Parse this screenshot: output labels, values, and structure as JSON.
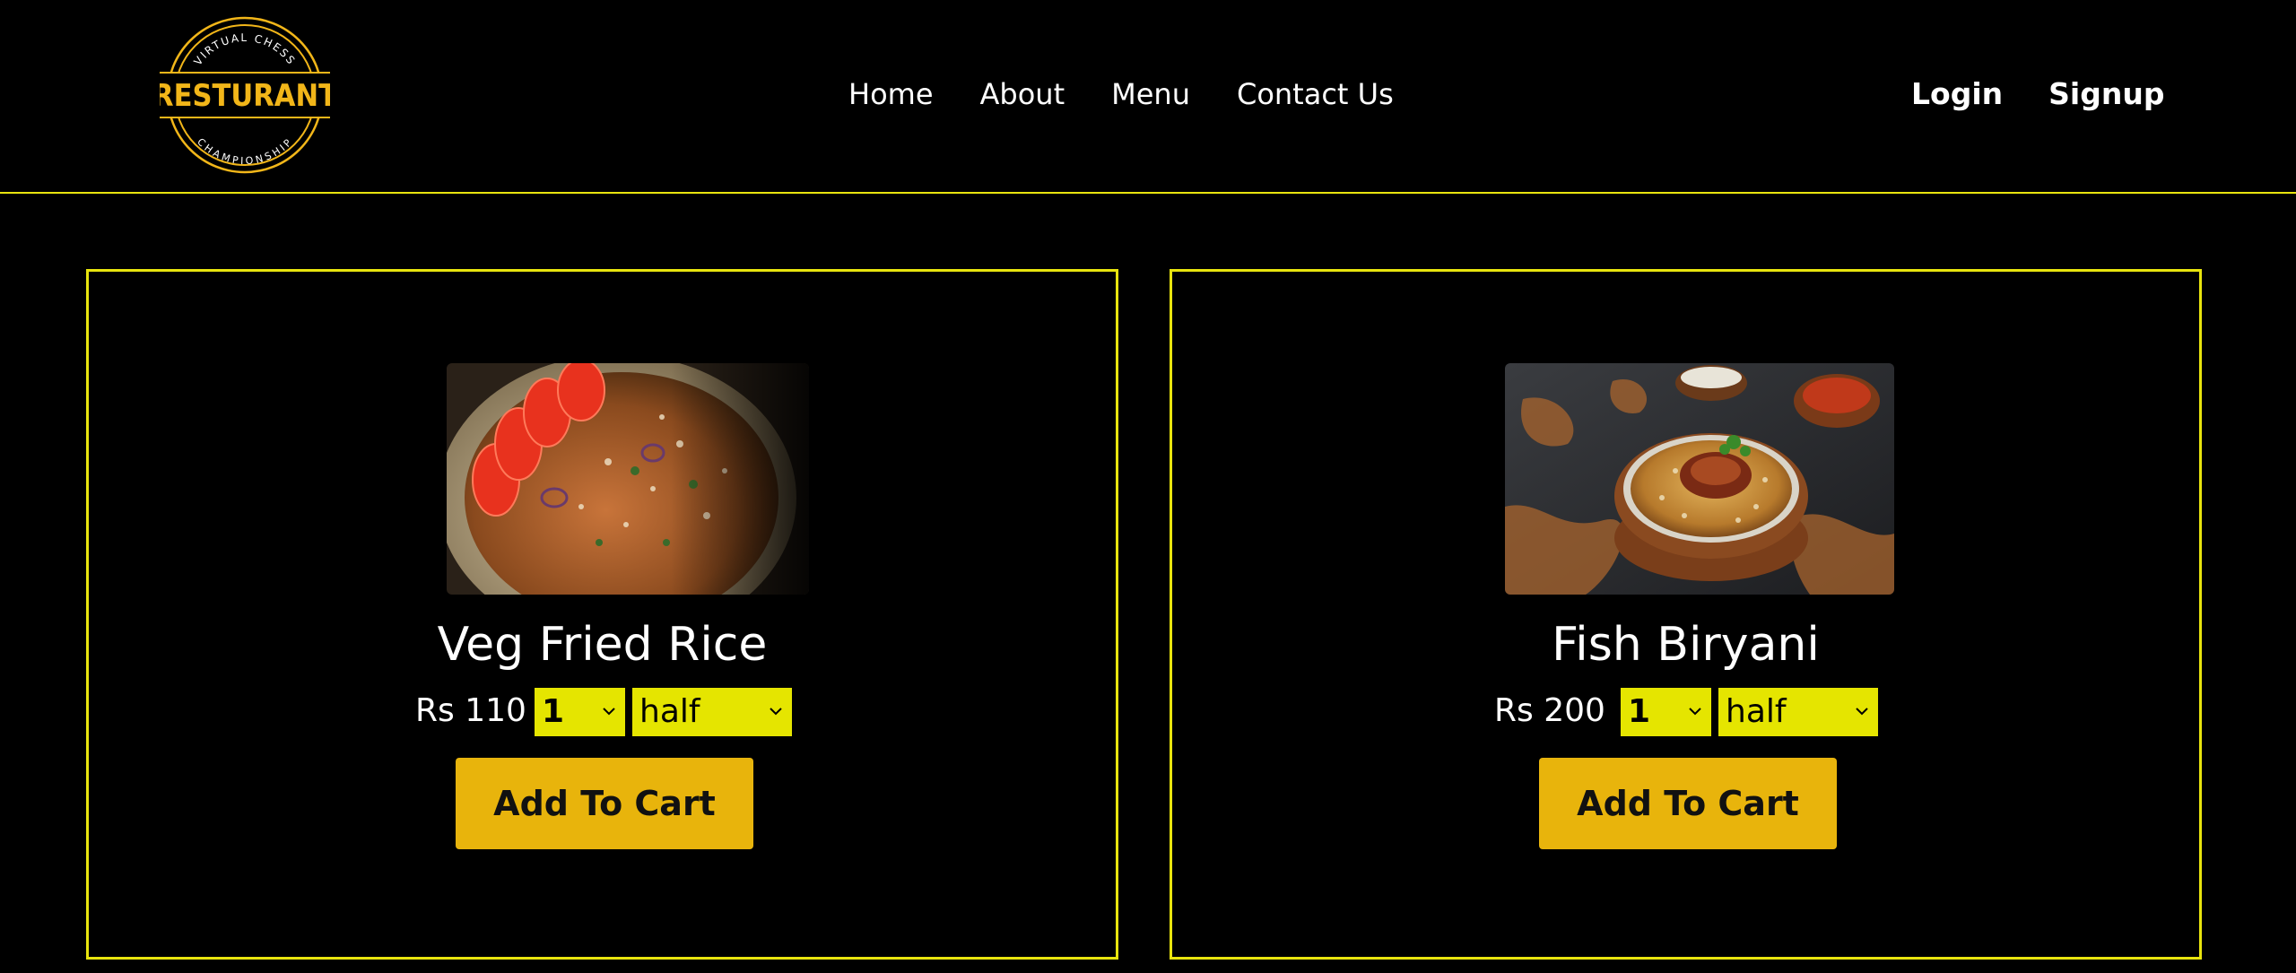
{
  "brand": {
    "logo_top": "VIRTUAL CHESS",
    "logo_main": "RESTURANT",
    "logo_bottom": "CHAMPIONSHIP",
    "accent_color": "#e8e40e",
    "logo_color": "#f2b619"
  },
  "nav": {
    "items": [
      {
        "label": "Home"
      },
      {
        "label": "About"
      },
      {
        "label": "Menu"
      },
      {
        "label": "Contact Us"
      }
    ]
  },
  "auth": {
    "login_label": "Login",
    "signup_label": "Signup"
  },
  "menu_items": [
    {
      "name": "Veg Fried Rice",
      "price": "Rs 110",
      "quantity": "1",
      "size": "half",
      "add_label": "Add To Cart",
      "image_alt": "veg-fried-rice-photo"
    },
    {
      "name": "Fish Biryani",
      "price": "Rs 200",
      "quantity": "1",
      "size": "half",
      "add_label": "Add To Cart",
      "image_alt": "fish-biryani-photo"
    }
  ],
  "colors": {
    "background": "#000000",
    "select_bg": "#e5e500",
    "button_bg": "#e8b40c"
  }
}
